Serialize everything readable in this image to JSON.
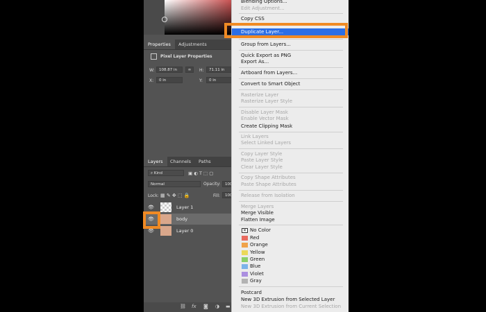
{
  "properties_tabs": [
    "Properties",
    "Adjustments"
  ],
  "properties": {
    "title": "Pixel Layer Properties",
    "w_label": "W:",
    "w_value": "108.87 in",
    "h_label": "H:",
    "h_value": "71.11 in",
    "x_label": "X:",
    "x_value": "0 in",
    "y_label": "Y:",
    "y_value": "0 in"
  },
  "layers_tabs": [
    "Layers",
    "Channels",
    "Paths"
  ],
  "layers_panel": {
    "kind_label": "Kind",
    "blend_mode": "Normal",
    "opacity_label": "Opacity:",
    "opacity_value": "100",
    "lock_label": "Lock:",
    "fill_label": "Fill:",
    "fill_value": "100"
  },
  "layers": [
    {
      "name": "Layer 1",
      "thumb": "transparent",
      "selected": false
    },
    {
      "name": "body",
      "thumb": "face",
      "selected": true
    },
    {
      "name": "Layer 0",
      "thumb": "face",
      "selected": false
    }
  ],
  "bottom_icons": [
    "link-icon",
    "fx-icon",
    "mask-icon",
    "adjustment-icon",
    "folder-icon"
  ],
  "menu": {
    "items": [
      {
        "label": "Blending Options...",
        "disabled": false
      },
      {
        "label": "Edit Adjustment...",
        "disabled": true
      },
      {
        "label": "Copy CSS",
        "disabled": false
      },
      {
        "label": "Duplicate Layer...",
        "disabled": false,
        "highlight": true
      },
      {
        "label": "Group from Layers...",
        "disabled": false
      },
      {
        "label": "Quick Export as PNG",
        "disabled": false
      },
      {
        "label": "Export As...",
        "disabled": false
      },
      {
        "label": "Artboard from Layers...",
        "disabled": false
      },
      {
        "label": "Convert to Smart Object",
        "disabled": false
      },
      {
        "label": "Rasterize Layer",
        "disabled": true
      },
      {
        "label": "Rasterize Layer Style",
        "disabled": true
      },
      {
        "label": "Disable Layer Mask",
        "disabled": true
      },
      {
        "label": "Enable Vector Mask",
        "disabled": true
      },
      {
        "label": "Create Clipping Mask",
        "disabled": false
      },
      {
        "label": "Link Layers",
        "disabled": true
      },
      {
        "label": "Select Linked Layers",
        "disabled": true
      },
      {
        "label": "Copy Layer Style",
        "disabled": true
      },
      {
        "label": "Paste Layer Style",
        "disabled": true
      },
      {
        "label": "Clear Layer Style",
        "disabled": true
      },
      {
        "label": "Copy Shape Attributes",
        "disabled": true
      },
      {
        "label": "Paste Shape Attributes",
        "disabled": true
      },
      {
        "label": "Release from Isolation",
        "disabled": true
      },
      {
        "label": "Merge Layers",
        "disabled": true
      },
      {
        "label": "Merge Visible",
        "disabled": false
      },
      {
        "label": "Flatten Image",
        "disabled": false
      },
      {
        "label": "Postcard",
        "disabled": false
      },
      {
        "label": "New 3D Extrusion from Selected Layer",
        "disabled": false
      },
      {
        "label": "New 3D Extrusion from Current Selection",
        "disabled": true
      }
    ],
    "colors": [
      {
        "label": "No Color",
        "hex": "#ffffff"
      },
      {
        "label": "Red",
        "hex": "#e96a5f"
      },
      {
        "label": "Orange",
        "hex": "#f0a24a"
      },
      {
        "label": "Yellow",
        "hex": "#ecd95a"
      },
      {
        "label": "Green",
        "hex": "#8bd06a"
      },
      {
        "label": "Blue",
        "hex": "#7cb3ea"
      },
      {
        "label": "Violet",
        "hex": "#ab8fe0"
      },
      {
        "label": "Gray",
        "hex": "#b3b3b3"
      }
    ]
  },
  "accent": "#f08a24",
  "selection_blue": "#2b6ee6"
}
